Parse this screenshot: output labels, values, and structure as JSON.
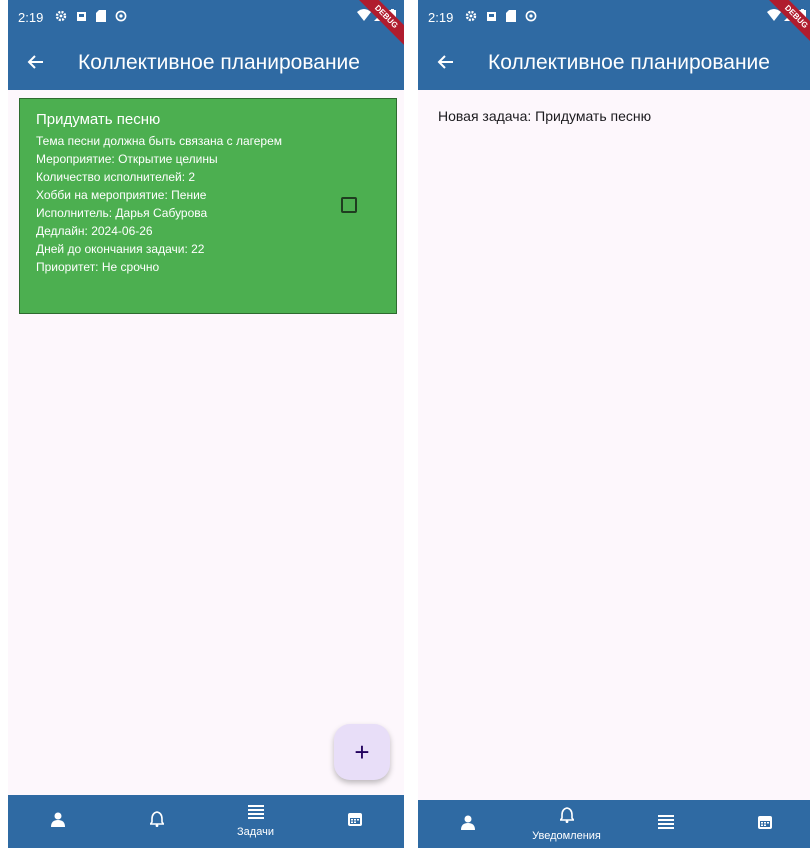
{
  "left": {
    "status": {
      "time": "2:19"
    },
    "debug_banner": "DEBUG",
    "app_title": "Коллективное планирование",
    "task_card": {
      "title": "Придумать песню",
      "description": "Тема песни должна быть связана с лагерем",
      "event": "Мероприятие: Открытие целины",
      "performers_count": "Количество исполнителей: 2",
      "hobby": "Хобби на мероприятие: Пение",
      "performer": "Исполнитель: Дарья Сабурова",
      "deadline": "Дедлайн: 2024-06-26",
      "days_left": "Дней до окончания задачи: 22",
      "priority": "Приоритет: Не срочно",
      "color": "#4caf50",
      "checked": false
    },
    "fab_label": "+",
    "nav": {
      "active": "tasks",
      "tasks_label": "Задачи"
    }
  },
  "right": {
    "status": {
      "time": "2:19"
    },
    "debug_banner": "DEBUG",
    "app_title": "Коллективное планирование",
    "notification": "Новая задача: Придумать песню",
    "nav": {
      "active": "notifications",
      "notifications_label": "Уведомления"
    }
  },
  "colors": {
    "appbar": "#2f6aa3",
    "background": "#fdf7fc",
    "fab": "#e8def8"
  },
  "icons": [
    "back-arrow-icon",
    "person-icon",
    "bell-icon",
    "list-icon",
    "calendar-icon",
    "gear-icon",
    "wifi-icon",
    "battery-icon"
  ]
}
